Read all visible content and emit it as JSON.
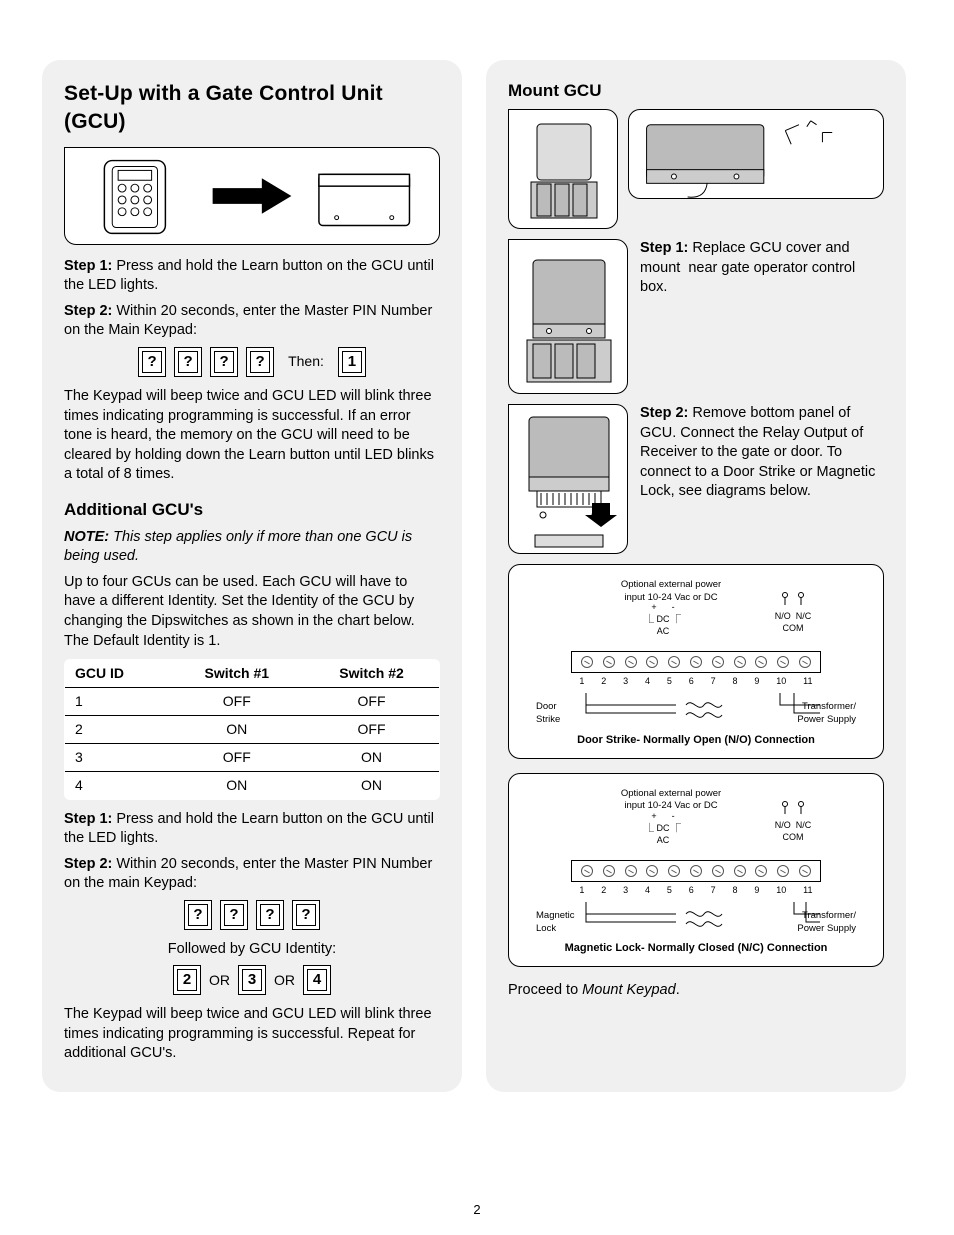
{
  "page_number": "2",
  "left": {
    "title": "Set-Up with a Gate Control Unit (GCU)",
    "step1": "Step 1: Press and hold the Learn button on the GCU until the LED lights.",
    "step2_lead": "Step 2: Within 20 seconds, enter the Master PIN Number on the Main Keypad:",
    "keys_pin": [
      "?",
      "?",
      "?",
      "?"
    ],
    "then_label": "Then:",
    "key_after": "1",
    "result_para": "The Keypad will beep twice and GCU LED will blink three times indicating programming is successful. If an error tone is heard, the memory on the GCU will need to be cleared by holding down the Learn button until LED blinks a total of 8 times.",
    "addl_heading": "Additional GCU's",
    "addl_note_bold": "NOTE:",
    "addl_note_rest": " This step applies only if more than one GCU is being used.",
    "addl_para": "Up to four GCUs can be used. Each GCU will have to have a different Identity. Set the Identity of the GCU by changing the Dipswitches as shown in the chart below. The Default Identity is 1.",
    "table": {
      "headers": [
        "GCU ID",
        "Switch #1",
        "Switch #2"
      ],
      "rows": [
        [
          "1",
          "OFF",
          "OFF"
        ],
        [
          "2",
          "ON",
          "OFF"
        ],
        [
          "3",
          "OFF",
          "ON"
        ],
        [
          "4",
          "ON",
          "ON"
        ]
      ]
    },
    "step1b": "Step 1: Press and hold the Learn button on the GCU until the LED lights.",
    "step2b": "Step 2: Within 20 seconds, enter the Master PIN Number on the main Keypad:",
    "keys_pin2": [
      "?",
      "?",
      "?",
      "?"
    ],
    "followed_label": "Followed by GCU Identity:",
    "identity_keys": [
      "2",
      "3",
      "4"
    ],
    "or_label": "OR",
    "result_para2": "The Keypad will beep twice and GCU LED will blink three times indicating programming is successful. Repeat for additional GCU's."
  },
  "right": {
    "title": "Mount GCU",
    "step1": "Step 1: Replace GCU cover and mount  near gate operator control box.",
    "step2": "Step 2: Remove bottom panel of GCU. Connect the Relay Output of Receiver to the gate or door. To connect to a Door Strike or Magnetic Lock, see diagrams below.",
    "wiring_common": {
      "optional_power": "Optional external power input 10-24 Vac or DC",
      "dc": "DC",
      "ac": "AC",
      "plus": "+",
      "minus": "-",
      "no": "N/O",
      "nc": "N/C",
      "com": "COM",
      "term_numbers": [
        "1",
        "2",
        "3",
        "4",
        "5",
        "6",
        "7",
        "8",
        "9",
        "10",
        "11"
      ],
      "transformer": "Transformer/ Power Supply"
    },
    "wiring1": {
      "left_label": "Door Strike",
      "caption": "Door Strike- Normally Open (N/O) Connection"
    },
    "wiring2": {
      "left_label": "Magnetic Lock",
      "caption": "Magnetic Lock- Normally Closed (N/C) Connection"
    },
    "proceed_lead": "Proceed to ",
    "proceed_em": "Mount Keypad",
    "proceed_tail": "."
  }
}
